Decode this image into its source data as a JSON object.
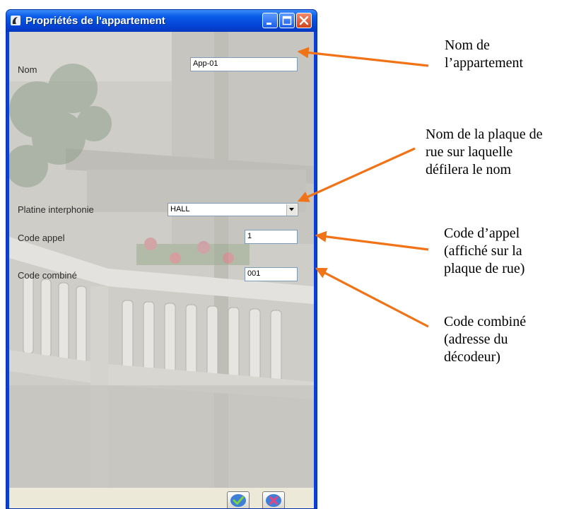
{
  "window": {
    "title": "Propriétés de l'appartement",
    "minimize_icon": "minimize-icon",
    "maximize_icon": "maximize-icon",
    "close_icon": "close-icon"
  },
  "form": {
    "nom": {
      "label": "Nom",
      "value": "App-01"
    },
    "platine": {
      "label": "Platine interphonie",
      "value": "HALL"
    },
    "code_appel": {
      "label": "Code appel",
      "value": "1"
    },
    "code_combine": {
      "label": "Code combiné",
      "value": "001"
    }
  },
  "buttons": {
    "ok_icon": "check-icon",
    "cancel_icon": "cancel-icon"
  },
  "annotations": [
    {
      "lines": [
        "Nom de",
        "l’appartement"
      ]
    },
    {
      "lines": [
        "Nom de la plaque de",
        "rue sur laquelle",
        "défilera le nom"
      ]
    },
    {
      "lines": [
        "Code d’appel",
        "(affiché sur la",
        "plaque de rue)"
      ]
    },
    {
      "lines": [
        "Code combiné",
        "(adresse du",
        "décodeur)"
      ]
    }
  ],
  "colors": {
    "arrow": "#f07317",
    "titlebar": "#0a5be8",
    "close_button": "#d2441c"
  }
}
